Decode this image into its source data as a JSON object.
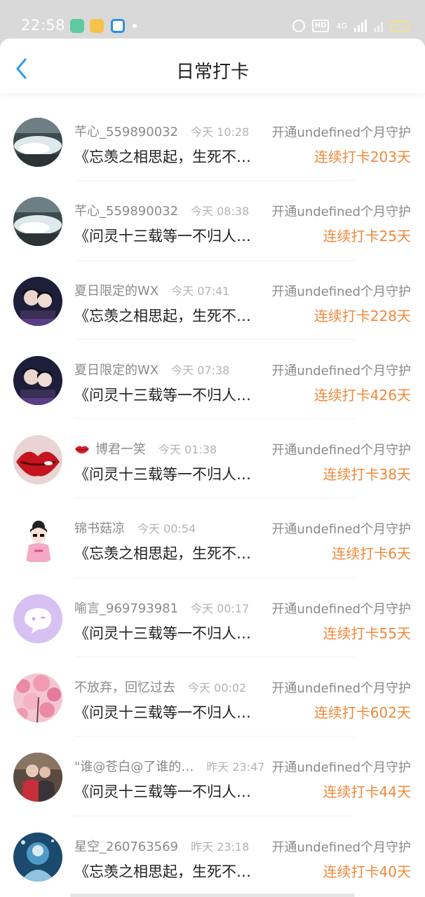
{
  "status_bar": {
    "time": "22:58",
    "network": "4G",
    "battery": "62"
  },
  "header": {
    "title": "日常打卡"
  },
  "colors": {
    "accent": "#2b9cf2",
    "streak": "#f0883a"
  },
  "items": [
    {
      "name": "芊心_559890032",
      "time": "今天 10:28",
      "guard": "开通undefined个月守护",
      "content": "《忘羡之相思起，生死不…",
      "streak": "连续打卡203天",
      "avatar": "waterfall-photo"
    },
    {
      "name": "芊心_559890032",
      "time": "今天 08:38",
      "guard": "开通undefined个月守护",
      "content": "《问灵十三载等一不归人…",
      "streak": "连续打卡25天",
      "avatar": "waterfall-photo"
    },
    {
      "name": "夏日限定的WX",
      "time": "今天 07:41",
      "guard": "开通undefined个月守护",
      "content": "《忘羡之相思起，生死不…",
      "streak": "连续打卡228天",
      "avatar": "two-people-photo"
    },
    {
      "name": "夏日限定的WX",
      "time": "今天 07:38",
      "guard": "开通undefined个月守护",
      "content": "《问灵十三载等一不归人…",
      "streak": "连续打卡426天",
      "avatar": "two-people-photo"
    },
    {
      "name": "博君一笑",
      "time": "今天 01:38",
      "guard": "开通undefined个月守护",
      "content": "《问灵十三载等一不归人…",
      "streak": "连续打卡38天",
      "avatar": "lips-photo",
      "name_icon": "lips-icon"
    },
    {
      "name": "锦书菇凉",
      "time": "今天 00:54",
      "guard": "开通undefined个月守护",
      "content": "《忘羡之相思起，生死不…",
      "streak": "连续打卡6天",
      "avatar": "cartoon-girl"
    },
    {
      "name": "喻言_969793981",
      "time": "今天 00:17",
      "guard": "开通undefined个月守护",
      "content": "《问灵十三载等一不归人…",
      "streak": "连续打卡55天",
      "avatar": "default-chat-avatar"
    },
    {
      "name": "不放弃，回忆过去",
      "time": "今天 00:02",
      "guard": "开通undefined个月守护",
      "content": "《问灵十三载等一不归人…",
      "streak": "连续打卡602天",
      "avatar": "pink-blossom-photo"
    },
    {
      "name": "\"谁@苍白@了谁的…",
      "time": "昨天 23:47",
      "guard": "开通undefined个月守护",
      "content": "《问灵十三载等一不归人…",
      "streak": "连续打卡44天",
      "avatar": "costume-photo"
    },
    {
      "name": "星空_260763569",
      "time": "昨天 23:18",
      "guard": "开通undefined个月守护",
      "content": "《忘羡之相思起，生死不…",
      "streak": "连续打卡40天",
      "avatar": "blue-fantasy-photo"
    }
  ]
}
